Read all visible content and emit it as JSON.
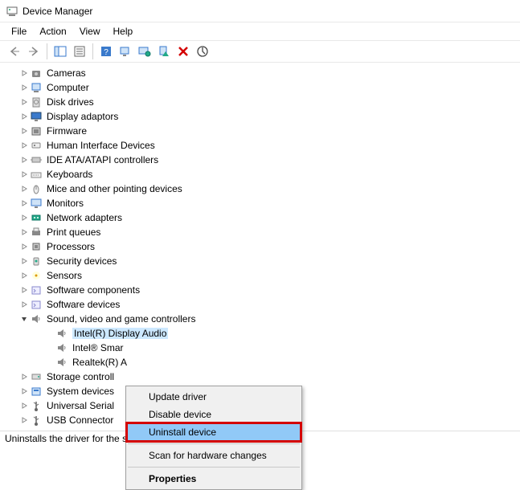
{
  "titlebar": {
    "title": "Device Manager"
  },
  "menubar": {
    "items": [
      "File",
      "Action",
      "View",
      "Help"
    ]
  },
  "tree": {
    "nodes": [
      {
        "label": "Cameras",
        "icon": "camera"
      },
      {
        "label": "Computer",
        "icon": "computer"
      },
      {
        "label": "Disk drives",
        "icon": "disk"
      },
      {
        "label": "Display adaptors",
        "icon": "display"
      },
      {
        "label": "Firmware",
        "icon": "firmware"
      },
      {
        "label": "Human Interface Devices",
        "icon": "hid"
      },
      {
        "label": "IDE ATA/ATAPI controllers",
        "icon": "controller"
      },
      {
        "label": "Keyboards",
        "icon": "keyboard"
      },
      {
        "label": "Mice and other pointing devices",
        "icon": "mouse"
      },
      {
        "label": "Monitors",
        "icon": "monitor"
      },
      {
        "label": "Network adapters",
        "icon": "network"
      },
      {
        "label": "Print queues",
        "icon": "printer"
      },
      {
        "label": "Processors",
        "icon": "processor"
      },
      {
        "label": "Security devices",
        "icon": "security"
      },
      {
        "label": "Sensors",
        "icon": "sensor"
      },
      {
        "label": "Software components",
        "icon": "software"
      },
      {
        "label": "Software devices",
        "icon": "software"
      },
      {
        "label": "Sound, video and game controllers",
        "icon": "speaker",
        "expanded": true,
        "children": [
          {
            "label": "Intel(R) Display Audio",
            "selected": true
          },
          {
            "label": "Intel® Smar"
          },
          {
            "label": "Realtek(R) A"
          }
        ]
      },
      {
        "label": "Storage controll",
        "icon": "storage"
      },
      {
        "label": "System devices",
        "icon": "system"
      },
      {
        "label": "Universal Serial ",
        "icon": "usb"
      },
      {
        "label": "USB Connector",
        "icon": "usb"
      }
    ]
  },
  "contextmenu": {
    "items": [
      {
        "label": "Update driver"
      },
      {
        "label": "Disable device"
      },
      {
        "label": "Uninstall device",
        "highlight": true
      },
      {
        "separator": true
      },
      {
        "label": "Scan for hardware changes"
      },
      {
        "separator": true
      },
      {
        "label": "Properties",
        "bold": true
      }
    ]
  },
  "statusbar": {
    "text": "Uninstalls the driver for the selected device."
  }
}
